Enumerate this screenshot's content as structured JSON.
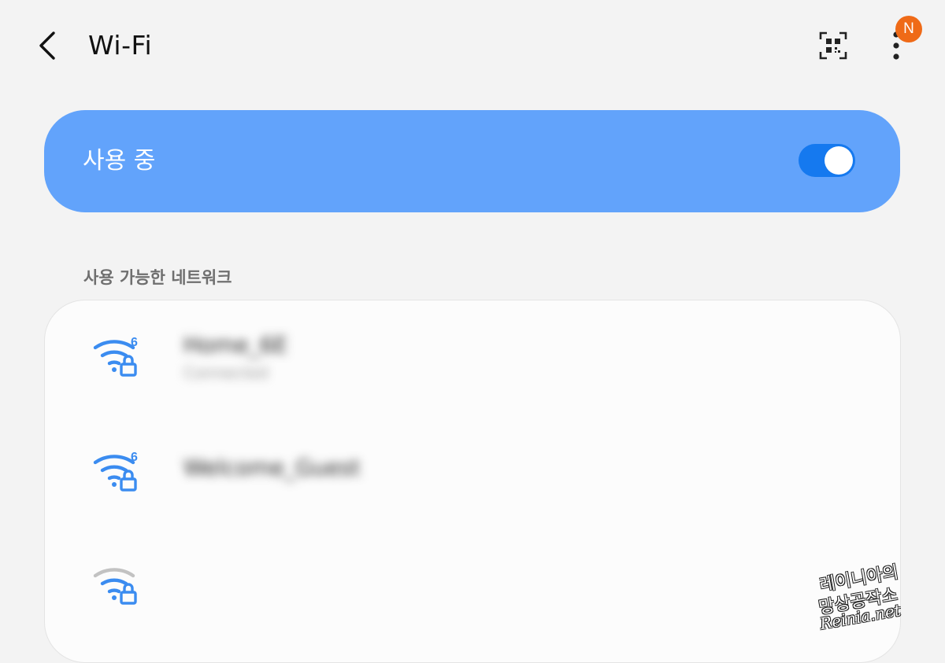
{
  "header": {
    "title": "Wi-Fi",
    "back_icon": "chevron-left-icon",
    "qr_icon": "qr-code-scanner-icon",
    "more_icon": "more-vertical-icon",
    "notification_badge": "N"
  },
  "master_switch": {
    "label": "사용 중",
    "state": "on",
    "accent_color": "#62a3fb",
    "toggle_color": "#1579ef"
  },
  "available_networks": {
    "header": "사용 가능한 네트워크",
    "items": [
      {
        "name": "Home_6E",
        "status": "Connected",
        "icon": "wifi-6-lock-icon",
        "signal_level": 1.0,
        "wifi6": true,
        "secured": true
      },
      {
        "name": "Welcome_Guest",
        "status": "",
        "icon": "wifi-6-lock-icon",
        "signal_level": 1.0,
        "wifi6": true,
        "secured": true
      },
      {
        "name": "",
        "status": "",
        "icon": "wifi-lock-icon",
        "signal_level": 0.75,
        "wifi6": false,
        "secured": true
      }
    ]
  },
  "watermark": {
    "line1": "레이니아의",
    "line2": "망상공작소",
    "line3": "Reinia.net"
  }
}
